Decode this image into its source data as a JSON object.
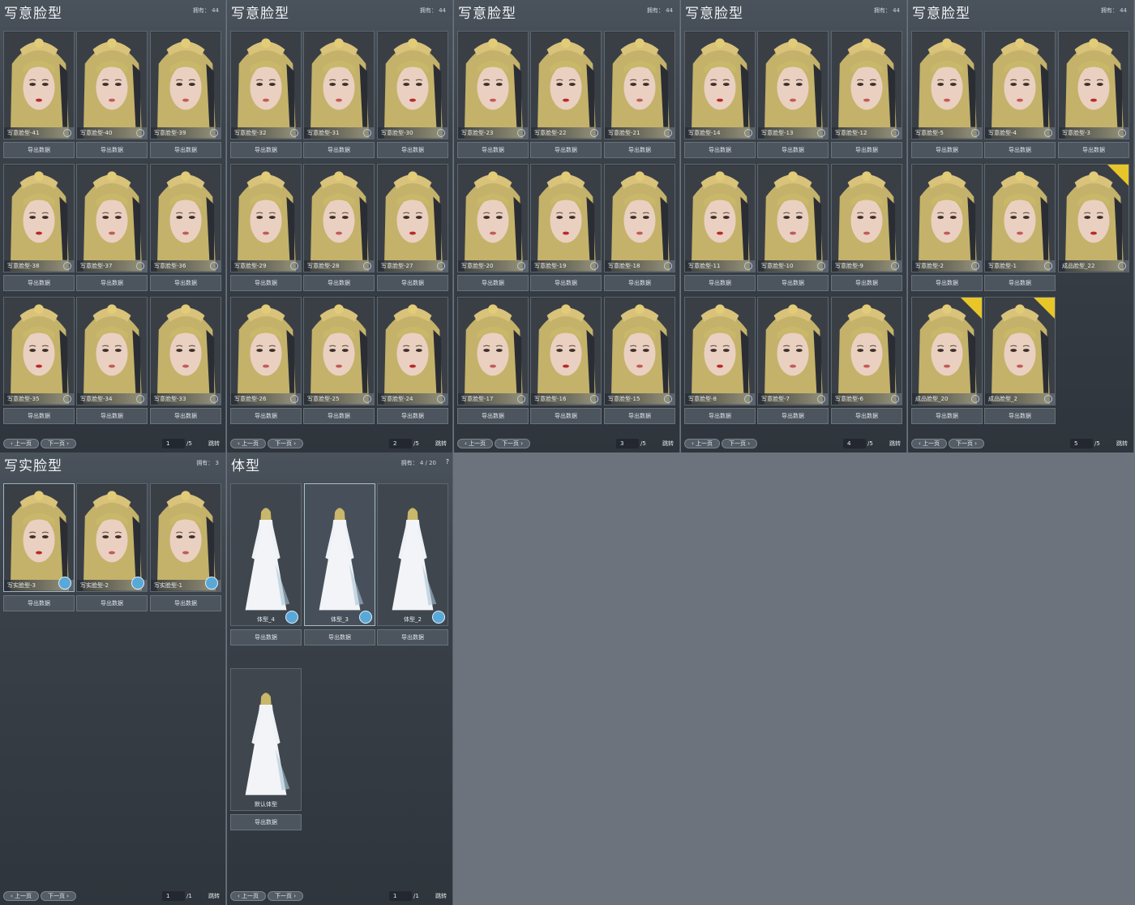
{
  "face_panels": [
    {
      "title": "写意脸型",
      "count": "拥有： 44",
      "cards": [
        "写意脸型-41",
        "写意脸型-40",
        "写意脸型-39",
        "写意脸型-38",
        "写意脸型-37",
        "写意脸型-36",
        "写意脸型-35",
        "写意脸型-34",
        "写意脸型-33"
      ],
      "badges": [
        false,
        false,
        false,
        false,
        false,
        false,
        false,
        false,
        false
      ],
      "page": "1",
      "total": "/5"
    },
    {
      "title": "写意脸型",
      "count": "拥有： 44",
      "cards": [
        "写意脸型-32",
        "写意脸型-31",
        "写意脸型-30",
        "写意脸型-29",
        "写意脸型-28",
        "写意脸型-27",
        "写意脸型-26",
        "写意脸型-25",
        "写意脸型-24"
      ],
      "badges": [
        false,
        false,
        false,
        false,
        false,
        false,
        false,
        false,
        false
      ],
      "page": "2",
      "total": "/5"
    },
    {
      "title": "写意脸型",
      "count": "拥有： 44",
      "cards": [
        "写意脸型-23",
        "写意脸型-22",
        "写意脸型-21",
        "写意脸型-20",
        "写意脸型-19",
        "写意脸型-18",
        "写意脸型-17",
        "写意脸型-16",
        "写意脸型-15"
      ],
      "badges": [
        false,
        false,
        false,
        false,
        false,
        false,
        false,
        false,
        false
      ],
      "page": "3",
      "total": "/5"
    },
    {
      "title": "写意脸型",
      "count": "拥有： 44",
      "cards": [
        "写意脸型-14",
        "写意脸型-13",
        "写意脸型-12",
        "写意脸型-11",
        "写意脸型-10",
        "写意脸型-9",
        "写意脸型-8",
        "写意脸型-7",
        "写意脸型-6"
      ],
      "badges": [
        false,
        false,
        false,
        false,
        false,
        false,
        false,
        false,
        false
      ],
      "page": "4",
      "total": "/5"
    },
    {
      "title": "写意脸型",
      "count": "拥有： 44",
      "cards": [
        "写意脸型-5",
        "写意脸型-4",
        "写意脸型-3",
        "写意脸型-2",
        "写意脸型-1",
        "成品脸型_22",
        "成品脸型_20",
        "成品脸型_2"
      ],
      "badges": [
        false,
        false,
        false,
        false,
        false,
        true,
        true,
        true
      ],
      "page": "5",
      "total": "/5"
    }
  ],
  "realistic_panel": {
    "title": "写实脸型",
    "count": "拥有： 3",
    "cards": [
      "写实脸型-3",
      "写实脸型-2",
      "写实脸型-1"
    ],
    "page": "1",
    "total": "/1"
  },
  "body_panel": {
    "title": "体型",
    "count": "拥有： 4 / 20",
    "help": "?",
    "cards": [
      "体型_4",
      "体型_3",
      "体型_2",
      "默认体型"
    ],
    "page": "1",
    "total": "/1"
  },
  "labels": {
    "export": "导出数据",
    "prev": "上一页",
    "next": "下一页",
    "jump": "跳转"
  },
  "colors": {
    "hair": "#c9b76a",
    "skin": "#e9c8b8",
    "lip": "#c23a3a",
    "badge": "#e8c62a",
    "select": "#5aa8d8"
  }
}
